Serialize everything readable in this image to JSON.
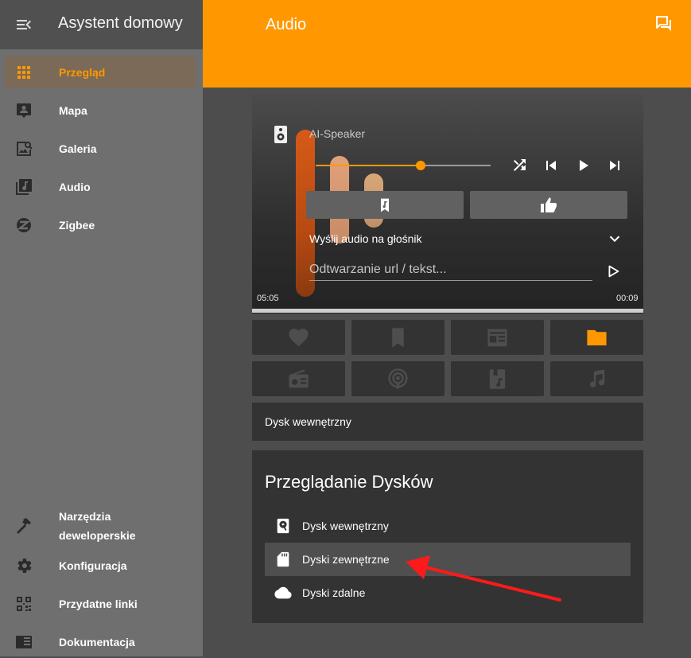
{
  "sidebar": {
    "title": "Asystent domowy",
    "items": [
      {
        "label": "Przegląd",
        "icon": "grid-icon"
      },
      {
        "label": "Mapa",
        "icon": "map-person-icon"
      },
      {
        "label": "Galeria",
        "icon": "gallery-icon"
      },
      {
        "label": "Audio",
        "icon": "music-library-icon"
      },
      {
        "label": "Zigbee",
        "icon": "zigbee-icon"
      }
    ],
    "bottom_items": [
      {
        "label_line1": "Narzędzia",
        "label_line2": "deweloperskie",
        "icon": "hammer-icon"
      },
      {
        "label": "Konfiguracja",
        "icon": "gear-icon"
      },
      {
        "label": "Przydatne linki",
        "icon": "qr-code-icon"
      },
      {
        "label": "Dokumentacja",
        "icon": "book-icon"
      }
    ]
  },
  "header": {
    "title": "Audio",
    "icon": "chat-icon"
  },
  "player": {
    "device_name": "AI-Speaker",
    "volume_fraction": 0.6,
    "send_audio_label": "Wyślij audio na głośnik",
    "url_placeholder": "Odtwarzanie url / tekst...",
    "time_elapsed": "05:05",
    "time_remaining": "00:09"
  },
  "source_tiles": [
    {
      "icon": "heart-icon",
      "active": false
    },
    {
      "icon": "bookmark-icon",
      "active": false
    },
    {
      "icon": "news-icon",
      "active": false
    },
    {
      "icon": "folder-icon",
      "active": true
    },
    {
      "icon": "radio-icon",
      "active": false
    },
    {
      "icon": "podcast-icon",
      "active": false
    },
    {
      "icon": "audiobook-icon",
      "active": false
    },
    {
      "icon": "music-note-icon",
      "active": false
    }
  ],
  "current_source": "Dysk wewnętrzny",
  "browse": {
    "title": "Przeglądanie Dysków",
    "items": [
      {
        "label": "Dysk wewnętrzny",
        "icon": "harddisk-icon"
      },
      {
        "label": "Dyski zewnętrzne",
        "icon": "sd-card-icon"
      },
      {
        "label": "Dyski zdalne",
        "icon": "cloud-icon"
      }
    ]
  },
  "colors": {
    "accent": "#ff9800",
    "annotation_arrow": "#ff1a1a"
  }
}
